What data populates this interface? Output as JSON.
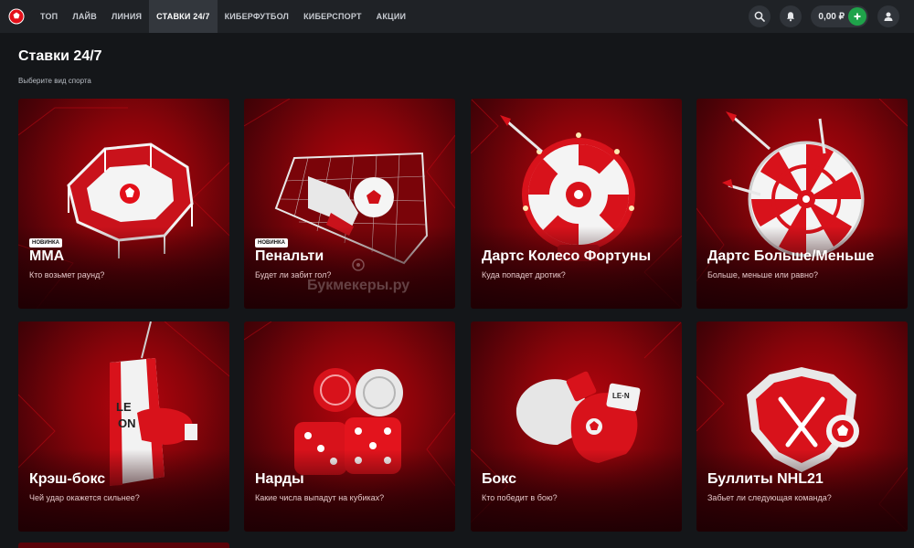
{
  "nav": {
    "items": [
      {
        "label": "ТОП",
        "active": false
      },
      {
        "label": "ЛАЙВ",
        "active": false
      },
      {
        "label": "ЛИНИЯ",
        "active": false
      },
      {
        "label": "СТАВКИ 24/7",
        "active": true
      },
      {
        "label": "КИБЕРФУТБОЛ",
        "active": false
      },
      {
        "label": "КИБЕРСПОРТ",
        "active": false
      },
      {
        "label": "АКЦИИ",
        "active": false
      }
    ],
    "balance": "0,00 ₽",
    "icons": [
      "logo-icon",
      "search-icon",
      "bell-icon",
      "plus-icon",
      "user-icon"
    ]
  },
  "page": {
    "title": "Ставки 24/7",
    "subtitle": "Выберите вид спорта"
  },
  "cards": [
    {
      "title": "MMA",
      "subtitle": "Кто возьмет раунд?",
      "badge": "НОВИНКА",
      "art": "octagon-ring"
    },
    {
      "title": "Пенальти",
      "subtitle": "Будет ли забит гол?",
      "badge": "НОВИНКА",
      "art": "goal-ball-boot"
    },
    {
      "title": "Дартс Колесо Фортуны",
      "subtitle": "Куда попадет дротик?",
      "badge": "",
      "art": "dart-wheel"
    },
    {
      "title": "Дартс Больше/Меньше",
      "subtitle": "Больше, меньше или равно?",
      "badge": "",
      "art": "dartboard"
    },
    {
      "title": "Крэш-бокс",
      "subtitle": "Чей удар окажется сильнее?",
      "badge": "",
      "art": "punching-bag"
    },
    {
      "title": "Нарды",
      "subtitle": "Какие числа выпадут на кубиках?",
      "badge": "",
      "art": "dice-checkers"
    },
    {
      "title": "Бокс",
      "subtitle": "Кто победит в бою?",
      "badge": "",
      "art": "boxing-gloves"
    },
    {
      "title": "Буллиты NHL21",
      "subtitle": "Забьет ли следующая команда?",
      "badge": "",
      "art": "hockey-shield"
    }
  ],
  "watermark": "Букмекеры.ру",
  "colors": {
    "accent_green": "#1fa34a",
    "card_red": "#b5050d",
    "topbar": "#1f2226",
    "background": "#141619"
  }
}
